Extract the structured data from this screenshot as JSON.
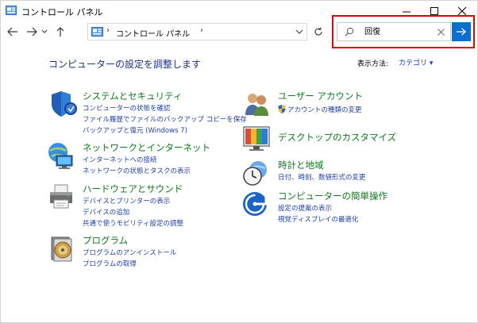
{
  "window": {
    "title": "コントロール パネル",
    "min_glyph": "—",
    "max_glyph": "☐",
    "close_glyph": "✕"
  },
  "nav": {
    "back_glyph": "←",
    "forward_glyph": "→",
    "recent_glyph": "⌄",
    "up_glyph": "↑"
  },
  "address": {
    "separator": "›",
    "crumb": "コントロール パネル",
    "crumb_separator": "›"
  },
  "search": {
    "value": "回復",
    "clear_glyph": "✕"
  },
  "header": {
    "heading": "コンピューターの設定を調整します",
    "view_by_label": "表示方法:",
    "view_by_value": "カテゴリ ▾"
  },
  "categories": {
    "system": {
      "title": "システムとセキュリティ",
      "links": [
        "コンピューターの状態を確認",
        "ファイル履歴でファイルのバックアップ コピーを保存",
        "バックアップと復元 (Windows 7)"
      ]
    },
    "network": {
      "title": "ネットワークとインターネット",
      "links": [
        "インターネットへの接続",
        "ネットワークの状態とタスクの表示"
      ]
    },
    "hardware": {
      "title": "ハードウェアとサウンド",
      "links": [
        "デバイスとプリンターの表示",
        "デバイスの追加",
        "共通で使うモビリティ設定の調整"
      ]
    },
    "programs": {
      "title": "プログラム",
      "links": [
        "プログラムのアンインストール",
        "プログラムの取得"
      ]
    },
    "users": {
      "title": "ユーザー アカウント",
      "links": [
        "アカウントの種類の変更"
      ]
    },
    "appearance": {
      "title": "デスクトップのカスタマイズ",
      "links": []
    },
    "clock": {
      "title": "時計と地域",
      "links": [
        "日付、時刻、数値形式の変更"
      ]
    },
    "ease": {
      "title": "コンピューターの簡単操作",
      "links": [
        "設定の提案の表示",
        "視覚ディスプレイの最適化"
      ]
    }
  },
  "colors": {
    "category_title": "#0e7a1c",
    "link": "#1f3fa8",
    "heading": "#1e3287",
    "accent": "#0a6fd1",
    "highlight_border": "#e00000"
  }
}
